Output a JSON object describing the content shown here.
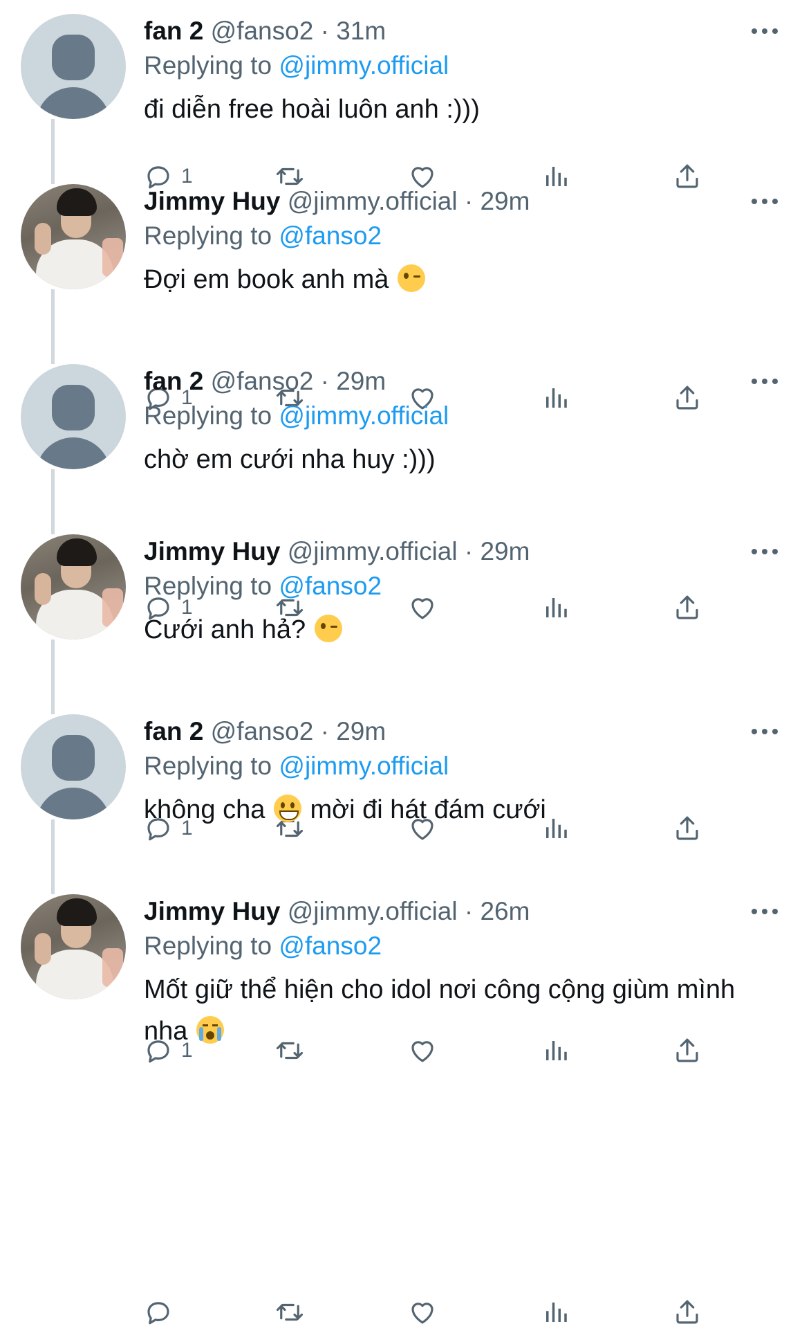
{
  "tweets": [
    {
      "name": "fan 2",
      "handle": "@fanso2",
      "separator": "·",
      "time": "31m",
      "reply_prefix": "Replying to",
      "reply_to": "@jimmy.official",
      "text": "đi diễn free hoài luôn anh :)))",
      "emoji": null,
      "text_after": "",
      "reply_count": "1",
      "avatar": "default-avatar"
    },
    {
      "name": "Jimmy Huy",
      "handle": "@jimmy.official",
      "separator": "·",
      "time": "29m",
      "reply_prefix": "Replying to",
      "reply_to": "@fanso2",
      "text": "Đợi em book anh mà",
      "emoji": "winking-face",
      "text_after": "",
      "reply_count": "1",
      "avatar": "photo-avatar"
    },
    {
      "name": "fan 2",
      "handle": "@fanso2",
      "separator": "·",
      "time": "29m",
      "reply_prefix": "Replying to",
      "reply_to": "@jimmy.official",
      "text": "chờ em cưới nha huy :)))",
      "emoji": null,
      "text_after": "",
      "reply_count": "1",
      "avatar": "default-avatar"
    },
    {
      "name": "Jimmy Huy",
      "handle": "@jimmy.official",
      "separator": "·",
      "time": "29m",
      "reply_prefix": "Replying to",
      "reply_to": "@fanso2",
      "text": "Cưới anh hả?",
      "emoji": "winking-face",
      "text_after": "",
      "reply_count": "1",
      "avatar": "photo-avatar"
    },
    {
      "name": "fan 2",
      "handle": "@fanso2",
      "separator": "·",
      "time": "29m",
      "reply_prefix": "Replying to",
      "reply_to": "@jimmy.official",
      "text": "không cha",
      "emoji": "grinning-face",
      "text_after": "mời đi hát đám cưới",
      "reply_count": "1",
      "avatar": "default-avatar"
    },
    {
      "name": "Jimmy Huy",
      "handle": "@jimmy.official",
      "separator": "·",
      "time": "26m",
      "reply_prefix": "Replying to",
      "reply_to": "@fanso2",
      "text": "Mốt giữ thể hiện cho idol nơi công cộng giùm mình nha",
      "emoji": "crying-face",
      "text_after": "",
      "reply_count": "",
      "avatar": "photo-avatar"
    }
  ],
  "action_icons": [
    "reply-icon",
    "retweet-icon",
    "like-icon",
    "views-icon",
    "share-icon"
  ],
  "colors": {
    "link": "#1d9bf0",
    "secondary": "#536471",
    "thread_line": "#cfd9de",
    "default_avatar_bg": "#ccd6dd"
  }
}
